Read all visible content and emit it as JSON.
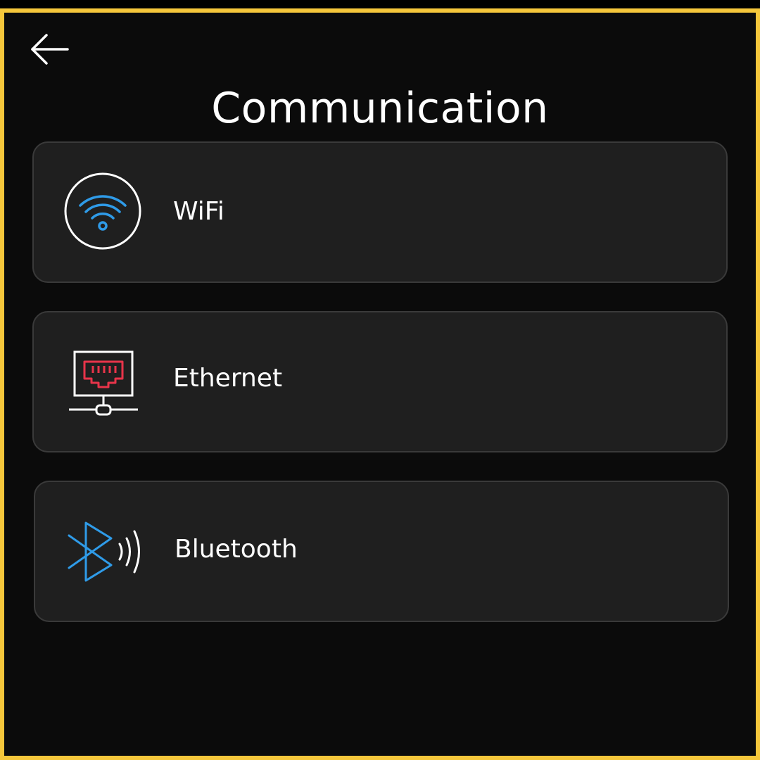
{
  "header": {
    "back_icon": "arrow-left-icon",
    "title": "Communication"
  },
  "options": [
    {
      "label": "WiFi",
      "icon": "wifi-icon",
      "icon_color": "#2f9be8"
    },
    {
      "label": "Ethernet",
      "icon": "ethernet-port-icon",
      "icon_color": "#e8344a"
    },
    {
      "label": "Bluetooth",
      "icon": "bluetooth-icon",
      "icon_color": "#2f9be8"
    }
  ],
  "colors": {
    "frame_border": "#f5c73b",
    "background": "#0b0b0b",
    "card_background": "#1f1f1f",
    "card_border": "#3a3a3a",
    "text": "#ffffff"
  }
}
